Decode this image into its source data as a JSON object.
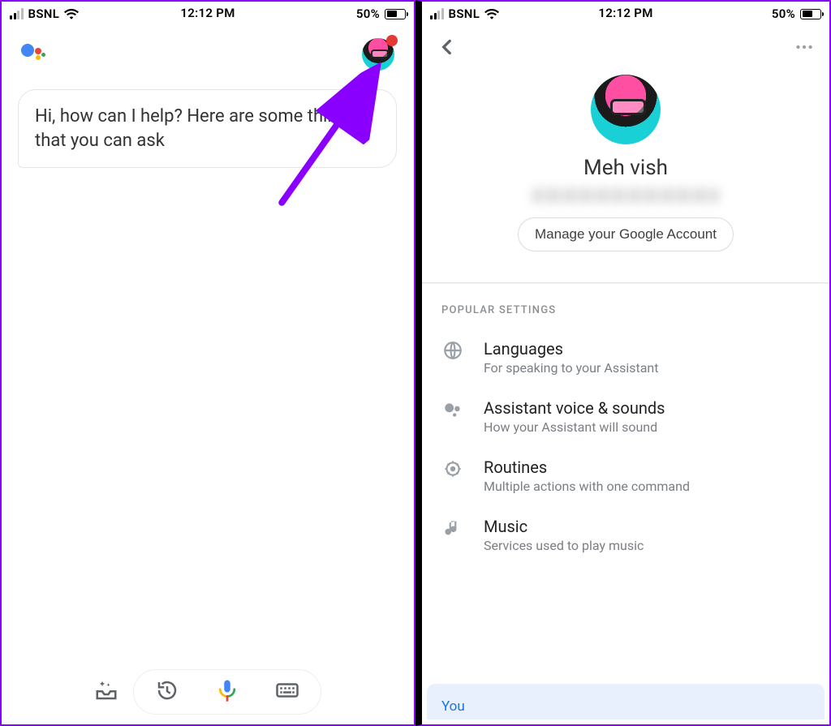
{
  "status": {
    "carrier": "BSNL",
    "time": "12:12 PM",
    "battery_pct": "50%"
  },
  "left": {
    "greeting": "Hi, how can I help? Here are some things that you can ask"
  },
  "right": {
    "account": {
      "name": "Meh vish",
      "manage_label": "Manage your Google Account"
    },
    "section_title": "POPULAR SETTINGS",
    "settings": [
      {
        "title": "Languages",
        "subtitle": "For speaking to your Assistant"
      },
      {
        "title": "Assistant voice & sounds",
        "subtitle": "How your Assistant will sound"
      },
      {
        "title": "Routines",
        "subtitle": "Multiple actions with one command"
      },
      {
        "title": "Music",
        "subtitle": "Services used to play music"
      }
    ],
    "tab_selected": "You"
  }
}
